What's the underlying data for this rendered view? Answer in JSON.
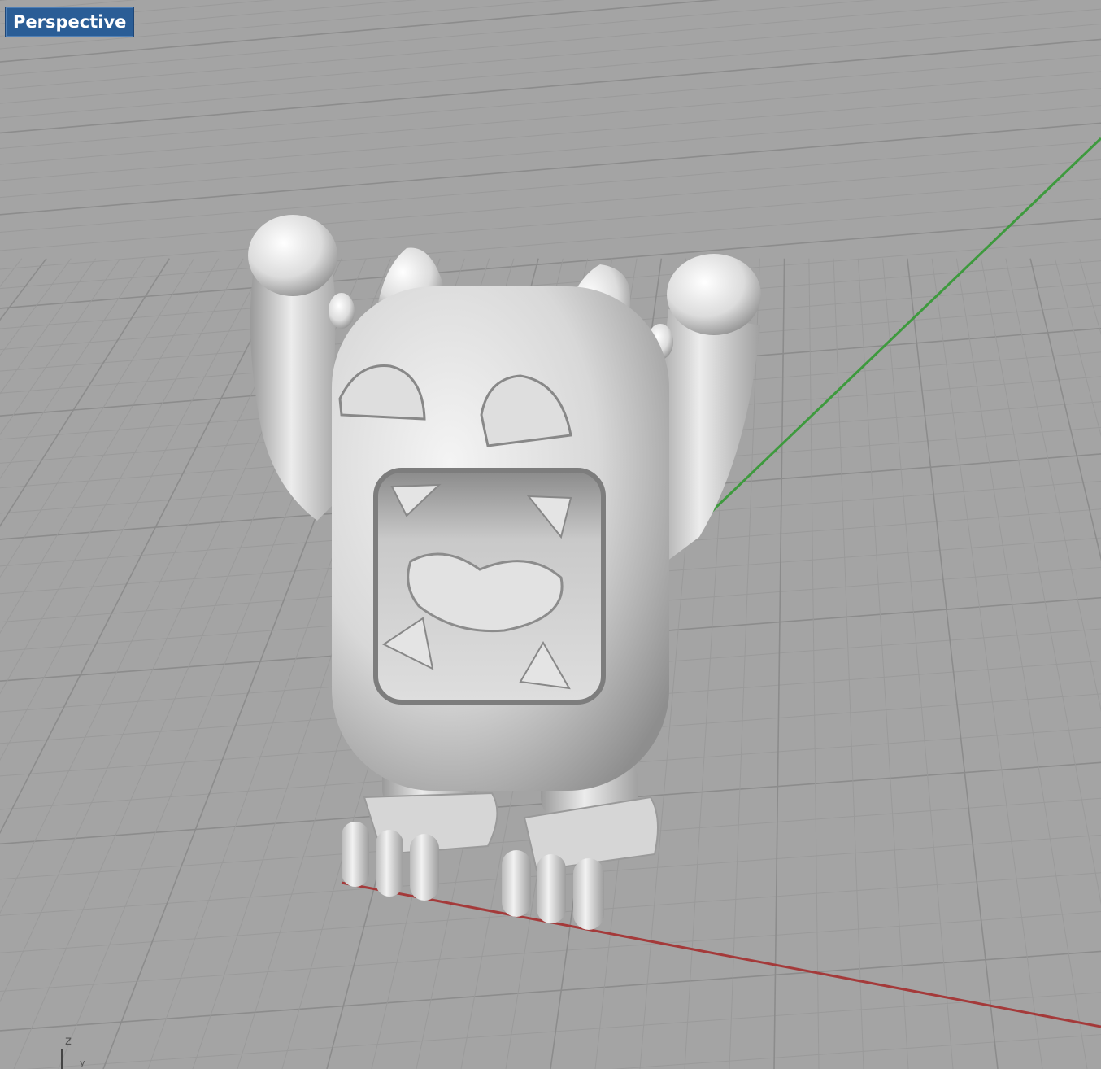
{
  "viewport": {
    "title": "Perspective"
  },
  "gizmo": {
    "z_label": "z",
    "y_label": "y"
  },
  "colors": {
    "background": "#a4a4a4",
    "grid_minor": "#9a9a9a",
    "grid_major": "#8c8c8c",
    "x_axis": "#a43a3a",
    "y_axis": "#3e9a3e",
    "model": "#e6e6e6",
    "label_bg": "#2a5d96"
  }
}
